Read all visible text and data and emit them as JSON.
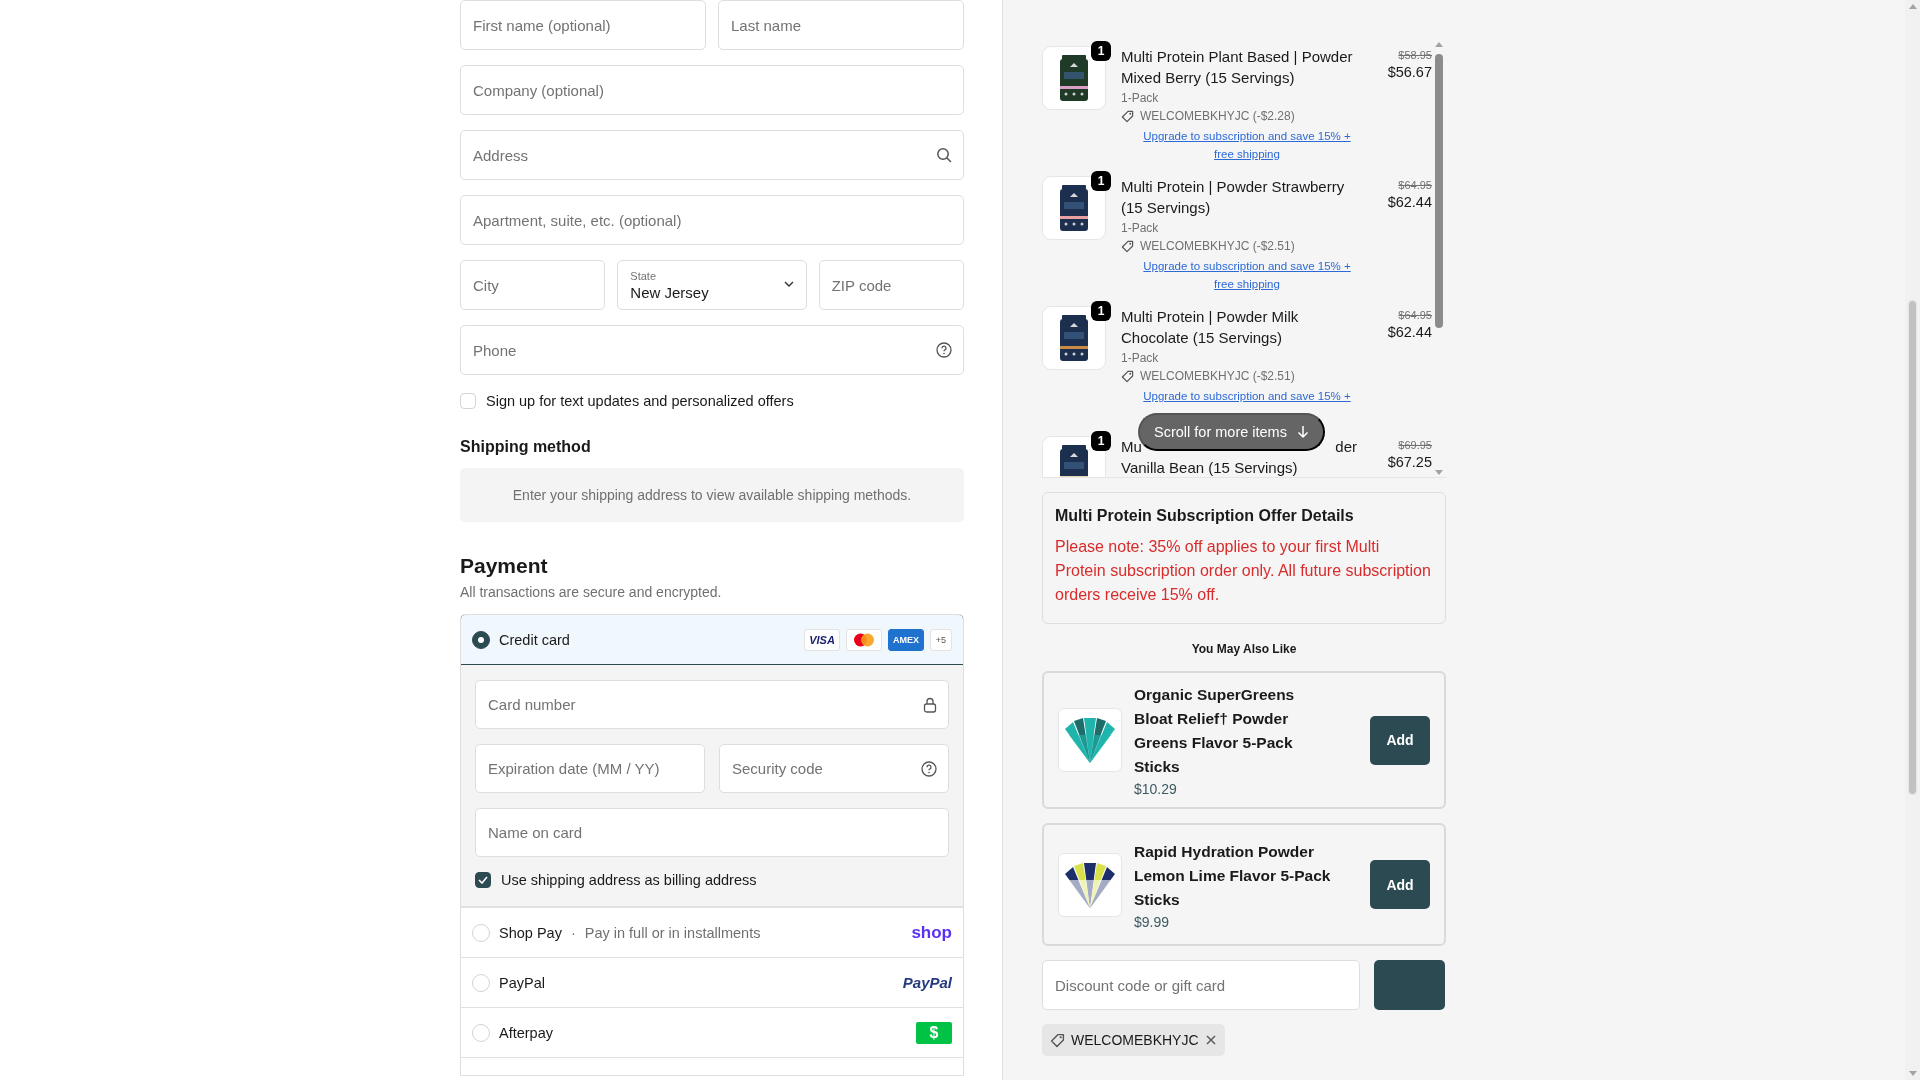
{
  "address_form": {
    "rows": [
      [
        {
          "placeholder": "First name (optional)"
        },
        {
          "placeholder": "Last name"
        }
      ],
      [
        {
          "placeholder": "Company (optional)"
        }
      ],
      [
        {
          "placeholder": "Address"
        }
      ],
      [
        {
          "placeholder": "Apartment, suite, etc. (optional)"
        }
      ],
      [
        {
          "placeholder": "City"
        },
        {
          "kind": "select",
          "label": "State",
          "value": "New Jersey"
        },
        {
          "placeholder": "ZIP code"
        }
      ],
      [
        {
          "placeholder": "Phone"
        }
      ]
    ],
    "sms_opt_in": {
      "label": "Sign up for text updates and personalized offers",
      "checked": false
    }
  },
  "shipping": {
    "heading": "Shipping method",
    "notice": "Enter your shipping address to view available shipping methods."
  },
  "payment": {
    "heading": "Payment",
    "subtitle": "All transactions are secure and encrypted.",
    "methods": [
      {
        "label": "Credit card",
        "selected": true,
        "brands": [
          {
            "kind": "visa",
            "label": "VISA"
          },
          {
            "kind": "mastercard"
          },
          {
            "kind": "amex",
            "label": "AMEX"
          },
          {
            "kind": "more",
            "label": "+5"
          }
        ]
      },
      {
        "label": "Shop Pay",
        "separator": "·",
        "detail": "Pay in full or in installments",
        "selected": false,
        "logo": {
          "kind": "shop",
          "label": "shop"
        }
      },
      {
        "label": "PayPal",
        "selected": false,
        "logo": {
          "kind": "paypal",
          "label": "PayPal"
        }
      },
      {
        "label": "Afterpay",
        "selected": false,
        "logo": {
          "kind": "dollar",
          "label": "$"
        }
      }
    ],
    "card_form": {
      "rows": [
        [
          {
            "placeholder": "Card number"
          }
        ],
        [
          {
            "placeholder": "Expiration date (MM / YY)"
          },
          {
            "placeholder": "Security code"
          }
        ],
        [
          {
            "placeholder": "Name on card"
          }
        ]
      ],
      "billing_same": {
        "label": "Use shipping address as billing address",
        "checked": true
      }
    }
  },
  "order_summary": {
    "items": [
      {
        "quantity": "1",
        "title": "Multi Protein Plant Based | Powder Mixed Berry (15 Servings)",
        "variant": "1-Pack",
        "discount": "WELCOMEBKHYJC (-$2.28)",
        "upgrade_link": "Upgrade to subscription and save 15% + free shipping",
        "compare_price": "$58.95",
        "price": "$56.67"
      },
      {
        "quantity": "1",
        "title": "Multi Protein | Powder Strawberry (15 Servings)",
        "variant": "1-Pack",
        "discount": "WELCOMEBKHYJC (-$2.51)",
        "upgrade_link": "Upgrade to subscription and save 15% + free shipping",
        "compare_price": "$64.95",
        "price": "$62.44"
      },
      {
        "quantity": "1",
        "title": "Multi Protein | Powder Milk Chocolate (15 Servings)",
        "variant": "1-Pack",
        "discount": "WELCOMEBKHYJC (-$2.51)",
        "upgrade_link": "Upgrade to subscription and save 15% +",
        "compare_price": "$64.95",
        "price": "$62.44"
      },
      {
        "quantity": "1",
        "title_fragments": [
          "Mu",
          "der"
        ],
        "title_line_2": "Vanilla Bean (15 Servings)",
        "compare_price": "$69.95",
        "price": "$67.25"
      }
    ],
    "scroll_hint": "Scroll for more items"
  },
  "offer": {
    "title": "Multi Protein Subscription Offer Details",
    "note": "Please note: 35% off applies to your first Multi Protein subscription order only. All future subscription orders receive 15% off."
  },
  "recommendations": {
    "heading": "You May Also Like",
    "items": [
      {
        "title": "Organic SuperGreens Bloat Relief† Powder Greens Flavor 5-Pack Sticks",
        "price": "$10.29",
        "button": "Add"
      },
      {
        "title": "Rapid Hydration Powder Lemon Lime Flavor 5-Pack Sticks",
        "price": "$9.99",
        "button": "Add"
      }
    ]
  },
  "discount": {
    "placeholder": "Discount code or gift card"
  },
  "applied_codes": [
    {
      "code": "WELCOMEBKHYJC"
    }
  ]
}
